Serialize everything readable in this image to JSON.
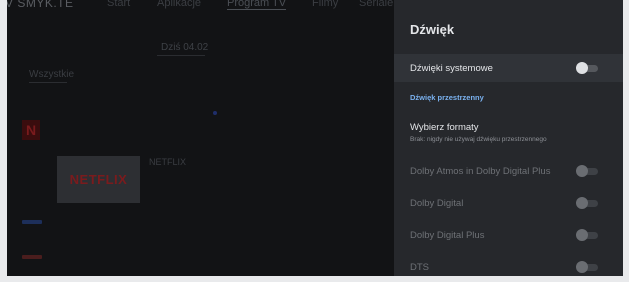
{
  "background_app": {
    "brand": "V SMYK.TE",
    "nav": [
      "Start",
      "Aplikacje",
      "Program TV",
      "Filmy",
      "Seriale"
    ],
    "date_chip": "Dziś 04.02",
    "filter": "Wszystkie",
    "netflix_tile_text": "NETFLIX",
    "netflix_channel_title": "NETFLIX",
    "channel_logo_glyph": "N"
  },
  "panel": {
    "title": "Dźwięk",
    "system_sounds": {
      "label": "Dźwięki systemowe",
      "on": false,
      "enabled": true
    },
    "surround_section": "Dźwięk przestrzenny",
    "choose_formats": {
      "label": "Wybierz formaty",
      "subtitle": "Brak: nigdy nie używaj dźwięku przestrzennego"
    },
    "formats": [
      {
        "label": "Dolby Atmos in Dolby Digital Plus",
        "on": false,
        "enabled": false
      },
      {
        "label": "Dolby Digital",
        "on": false,
        "enabled": false
      },
      {
        "label": "Dolby Digital Plus",
        "on": false,
        "enabled": false
      },
      {
        "label": "DTS",
        "on": false,
        "enabled": false
      }
    ]
  },
  "colors": {
    "panel_bg": "#26282c",
    "accent": "#7ab1ef",
    "netflix_red": "#7a1b1d"
  }
}
